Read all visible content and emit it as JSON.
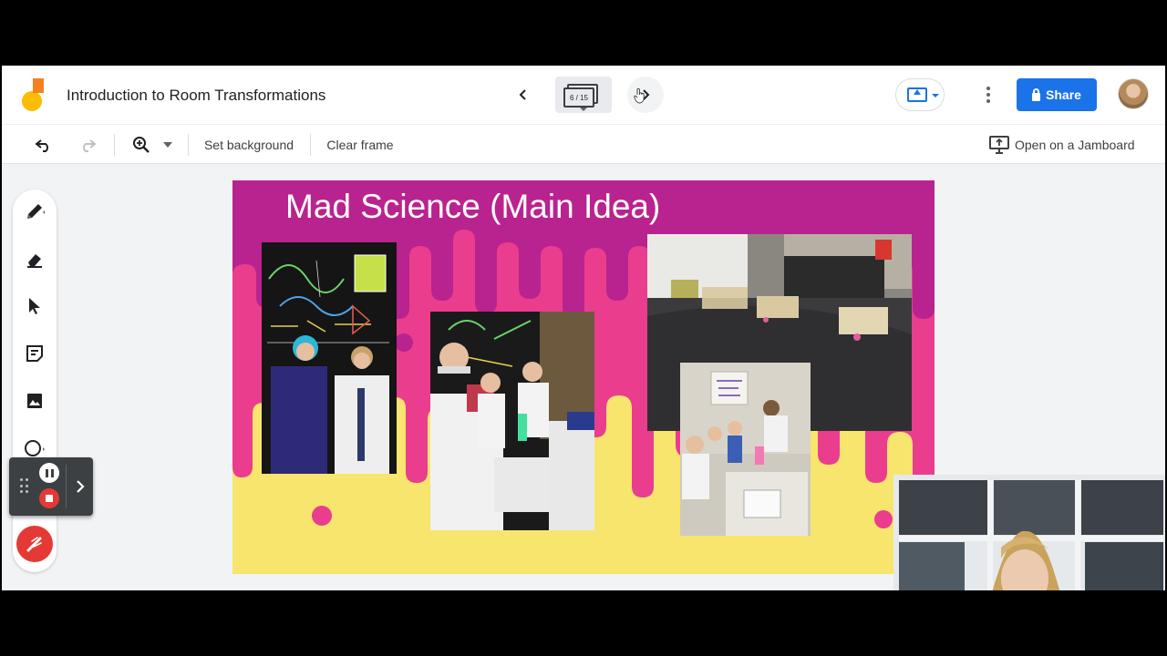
{
  "app": {
    "doc_title": "Introduction to Room Transformations",
    "frame_indicator": "6 / 15",
    "share_label": "Share"
  },
  "toolbar": {
    "set_background_label": "Set background",
    "clear_frame_label": "Clear frame",
    "open_on_jamboard_label": "Open on a Jamboard"
  },
  "tools": [
    "pen-icon",
    "eraser-icon",
    "select-icon",
    "sticky-note-icon",
    "image-icon",
    "circle-icon",
    "laser-icon"
  ],
  "slide": {
    "title": "Mad Science (Main Idea)"
  },
  "colors": {
    "accent_blue": "#1a73e8",
    "slide_magenta": "#b9238f",
    "slide_pink": "#ea3d8e",
    "slide_yellow": "#f7e56e",
    "laser_red": "#e53935"
  }
}
